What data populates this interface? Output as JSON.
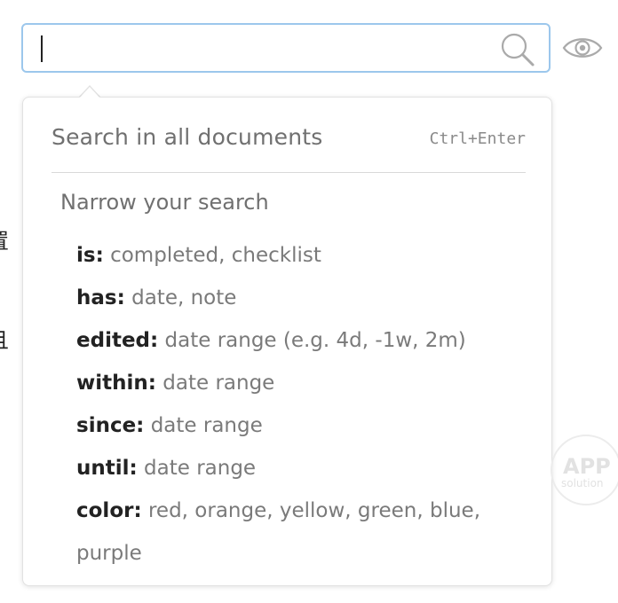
{
  "background": {
    "clipped_text_1": "置",
    "clipped_text_2": "且"
  },
  "search": {
    "value": "",
    "placeholder": "",
    "icon": "search-icon"
  },
  "visibility_toggle": {
    "icon": "eye-icon"
  },
  "dropdown": {
    "search_all_label": "Search in all documents",
    "search_all_shortcut": "Ctrl+Enter",
    "narrow_heading": "Narrow your search",
    "filters": [
      {
        "key": "is:",
        "values": "completed, checklist"
      },
      {
        "key": "has:",
        "values": "date, note"
      },
      {
        "key": "edited:",
        "values": "date range (e.g. 4d, -1w, 2m)"
      },
      {
        "key": "within:",
        "values": "date range"
      },
      {
        "key": "since:",
        "values": "date range"
      },
      {
        "key": "until:",
        "values": "date range"
      },
      {
        "key": "color:",
        "values": "red, orange, yellow, green, blue,"
      }
    ],
    "wrapped_line": "purple"
  },
  "watermark": {
    "big": "APP",
    "small": "solution"
  },
  "colors": {
    "input_border": "#9cc7ec",
    "icon_gray": "#aaaaaa",
    "muted_text": "#707070",
    "key_text": "#222222"
  }
}
